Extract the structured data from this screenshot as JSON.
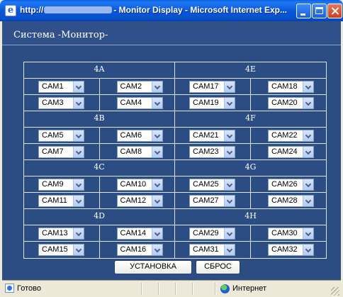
{
  "window": {
    "title_prefix": "http://",
    "title_suffix": "- Monitor Display - Microsoft Internet Exp..."
  },
  "page": {
    "title": "Система -Монитор-"
  },
  "groups": [
    {
      "left": {
        "label": "4A",
        "rows": [
          [
            "CAM1",
            "CAM2"
          ],
          [
            "CAM3",
            "CAM4"
          ]
        ]
      },
      "right": {
        "label": "4E",
        "rows": [
          [
            "CAM17",
            "CAM18"
          ],
          [
            "CAM19",
            "CAM20"
          ]
        ]
      }
    },
    {
      "left": {
        "label": "4B",
        "rows": [
          [
            "CAM5",
            "CAM6"
          ],
          [
            "CAM7",
            "CAM8"
          ]
        ]
      },
      "right": {
        "label": "4F",
        "rows": [
          [
            "CAM21",
            "CAM22"
          ],
          [
            "CAM23",
            "CAM24"
          ]
        ]
      }
    },
    {
      "left": {
        "label": "4C",
        "rows": [
          [
            "CAM9",
            "CAM10"
          ],
          [
            "CAM11",
            "CAM12"
          ]
        ]
      },
      "right": {
        "label": "4G",
        "rows": [
          [
            "CAM25",
            "CAM26"
          ],
          [
            "CAM27",
            "CAM28"
          ]
        ]
      }
    },
    {
      "left": {
        "label": "4D",
        "rows": [
          [
            "CAM13",
            "CAM14"
          ],
          [
            "CAM15",
            "CAM16"
          ]
        ]
      },
      "right": {
        "label": "4H",
        "rows": [
          [
            "CAM29",
            "CAM30"
          ],
          [
            "CAM31",
            "CAM32"
          ]
        ]
      }
    }
  ],
  "buttons": {
    "set_label": "УСТАНОВКА",
    "reset_label": "СБРОС"
  },
  "statusbar": {
    "status_text": "Готово",
    "zone_text": "Интернет"
  },
  "icons": {
    "app": "internet-explorer-icon",
    "minimize": "minimize-icon",
    "maximize": "maximize-icon",
    "close": "close-icon",
    "dropdown": "chevron-down-icon",
    "status": "page-done-icon",
    "zone": "globe-icon"
  },
  "colors": {
    "page_background": "#2c4d83",
    "titlebar": "#0a58d9",
    "close_button": "#d9542f",
    "grid_lines": "#dfe6f2"
  }
}
